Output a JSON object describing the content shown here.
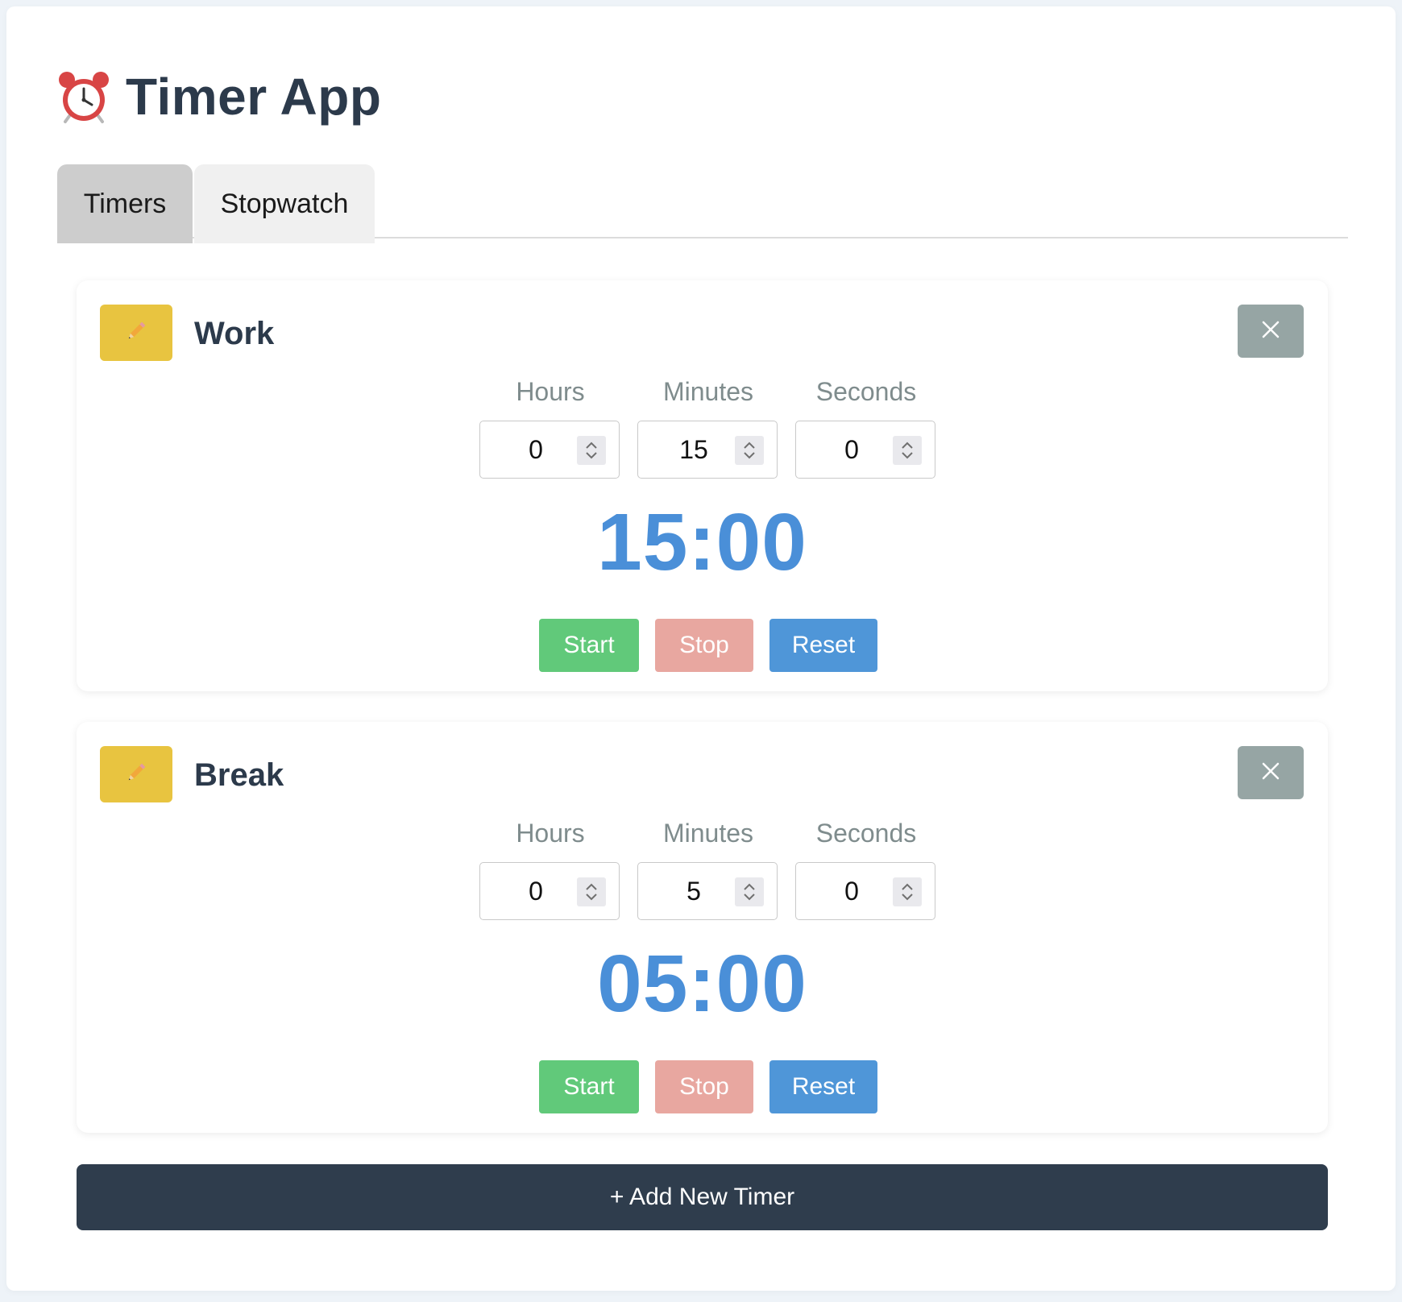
{
  "app": {
    "title": "Timer App",
    "title_icon": "alarm-clock-icon"
  },
  "tabs": [
    {
      "label": "Timers",
      "active": true
    },
    {
      "label": "Stopwatch",
      "active": false
    }
  ],
  "timers": [
    {
      "name": "Work",
      "edit_icon": "pencil-icon",
      "close_icon": "close-icon",
      "fields": [
        {
          "label": "Hours",
          "value": "0"
        },
        {
          "label": "Minutes",
          "value": "15"
        },
        {
          "label": "Seconds",
          "value": "0"
        }
      ],
      "display": "15:00",
      "actions": {
        "start": "Start",
        "stop": "Stop",
        "reset": "Reset"
      }
    },
    {
      "name": "Break",
      "edit_icon": "pencil-icon",
      "close_icon": "close-icon",
      "fields": [
        {
          "label": "Hours",
          "value": "0"
        },
        {
          "label": "Minutes",
          "value": "5"
        },
        {
          "label": "Seconds",
          "value": "0"
        }
      ],
      "display": "05:00",
      "actions": {
        "start": "Start",
        "stop": "Stop",
        "reset": "Reset"
      }
    }
  ],
  "add_button": {
    "label": "+ Add New Timer"
  },
  "colors": {
    "edit": "#e8c440",
    "close": "#96a5a4",
    "start": "#61c97a",
    "stop": "#e8a7a0",
    "reset": "#4f96d8",
    "display": "#4a8fd8",
    "add": "#2f3d4d"
  }
}
